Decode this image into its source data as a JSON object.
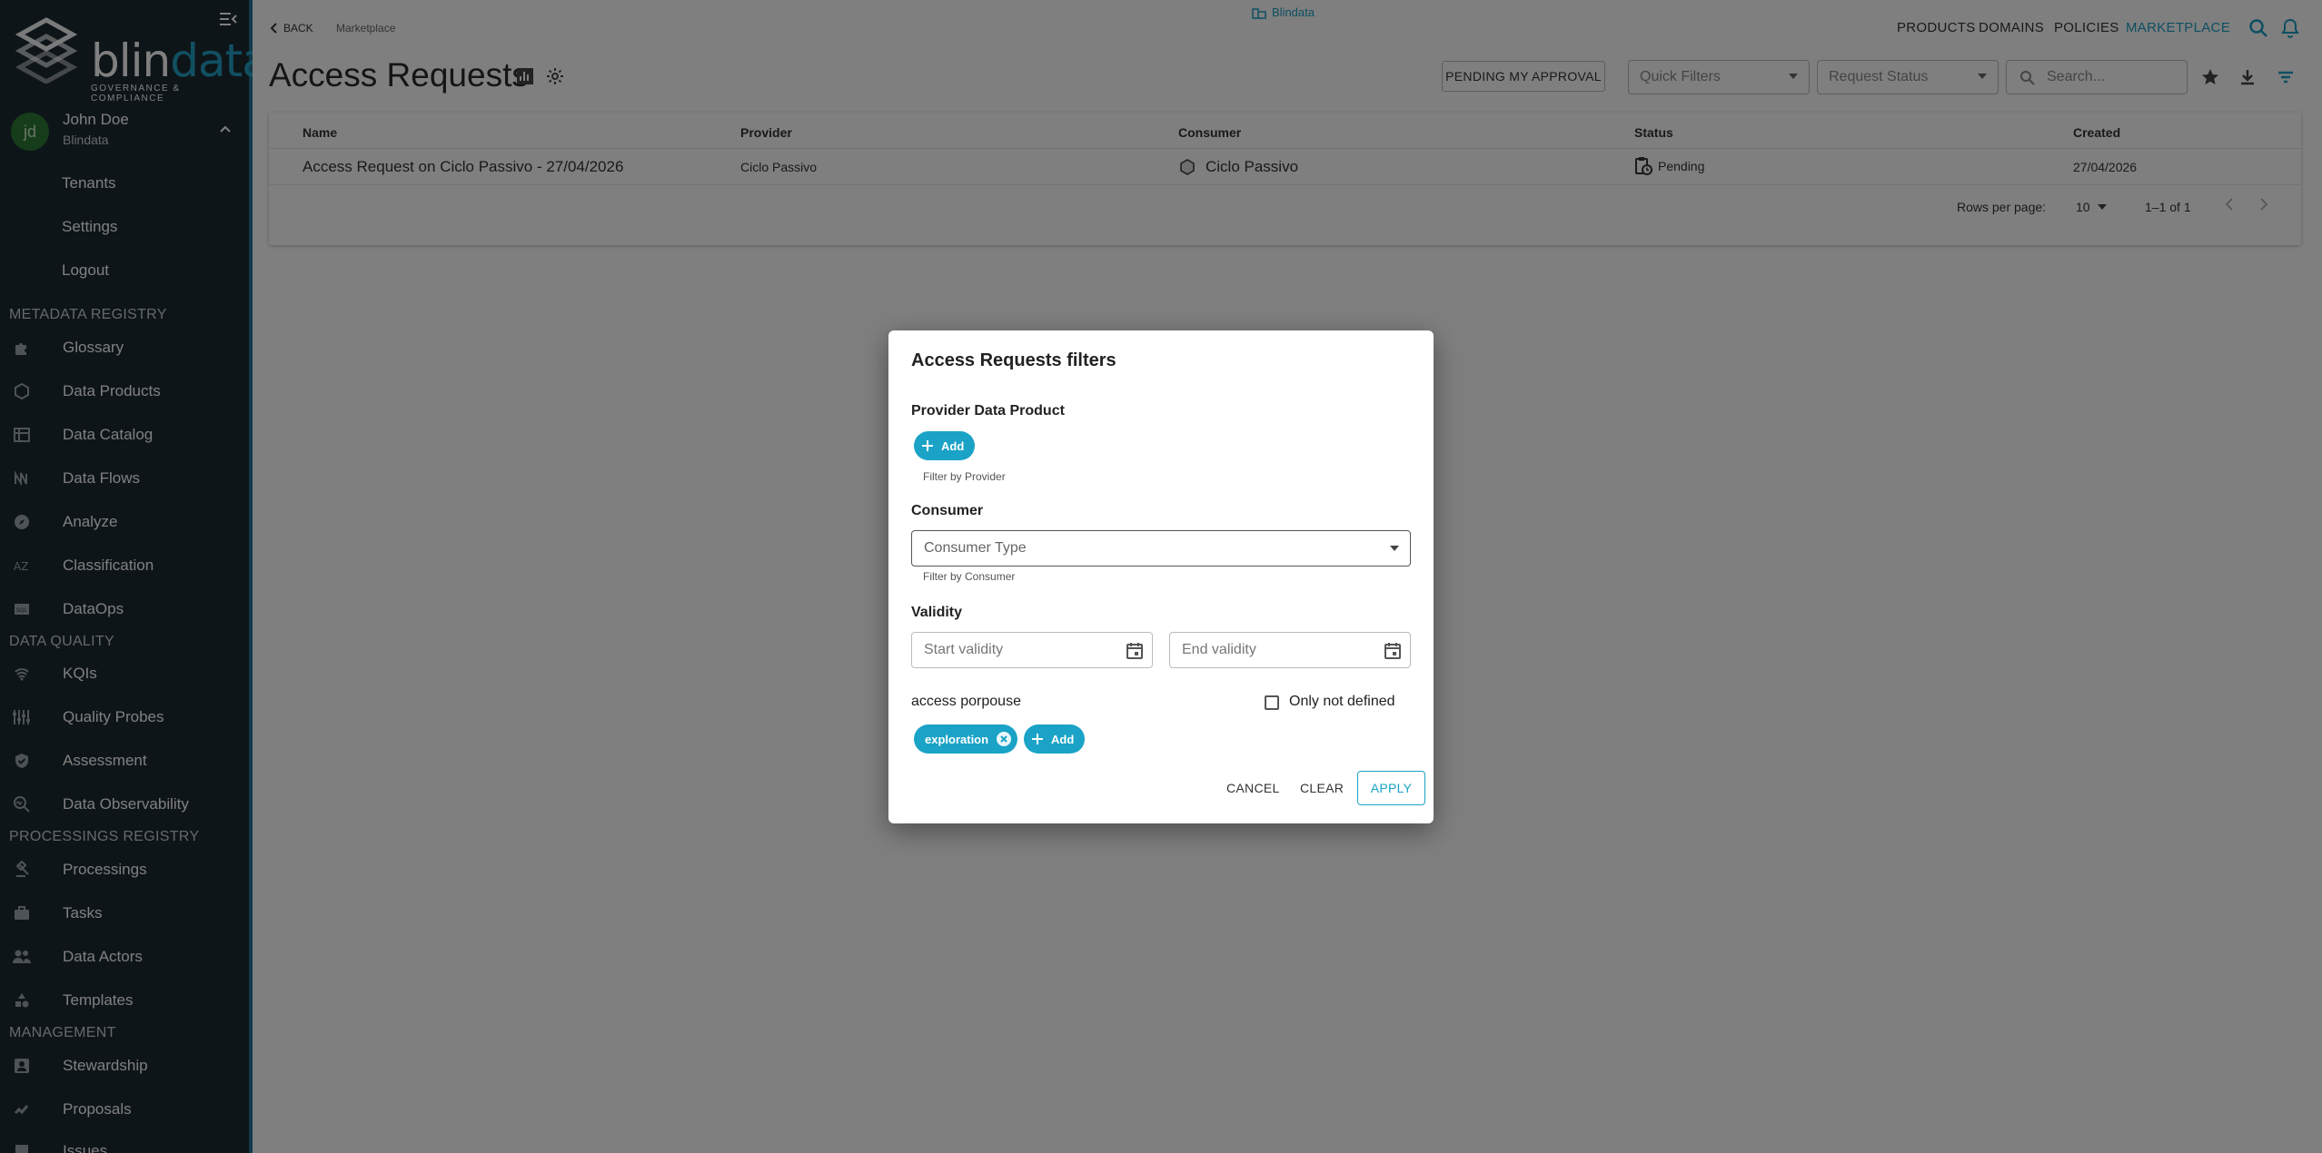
{
  "sidebar": {
    "logo_text_part1": "blin",
    "logo_text_part2": "data",
    "logo_subtitle": "GOVERNANCE & COMPLIANCE",
    "user": {
      "initials": "jd",
      "name": "John Doe",
      "tenant": "Blindata"
    },
    "account_links": [
      "Tenants",
      "Settings",
      "Logout"
    ],
    "sections": {
      "metadata": "METADATA REGISTRY",
      "quality": "DATA QUALITY",
      "processings": "PROCESSINGS REGISTRY",
      "management": "MANAGEMENT"
    },
    "metadata_items": [
      "Glossary",
      "Data Products",
      "Data Catalog",
      "Data Flows",
      "Analyze",
      "Classification",
      "DataOps"
    ],
    "quality_items": [
      "KQIs",
      "Quality Probes",
      "Assessment",
      "Data Observability"
    ],
    "processings_items": [
      "Processings",
      "Tasks",
      "Data Actors",
      "Templates"
    ],
    "management_items": [
      "Stewardship",
      "Proposals",
      "Issues"
    ]
  },
  "header": {
    "back_label": "BACK",
    "breadcrumb": "Marketplace",
    "tenant": "Blindata",
    "nav": [
      "PRODUCTS",
      "DOMAINS",
      "POLICIES",
      "MARKETPLACE"
    ],
    "active_nav": "MARKETPLACE"
  },
  "page": {
    "title": "Access Requests",
    "pending_button": "PENDING MY APPROVAL",
    "quick_filters_placeholder": "Quick Filters",
    "request_status_placeholder": "Request Status",
    "search_placeholder": "Search..."
  },
  "table": {
    "columns": [
      "Name",
      "Provider",
      "Consumer",
      "Status",
      "Created"
    ],
    "rows": [
      {
        "name": "Access Request on Ciclo Passivo - 27/04/2026",
        "provider": "Ciclo Passivo",
        "consumer": "Ciclo Passivo",
        "status": "Pending",
        "created": "27/04/2026"
      }
    ],
    "rows_per_page_label": "Rows per page:",
    "rows_per_page": "10",
    "range": "1–1 of 1"
  },
  "dialog": {
    "title": "Access Requests filters",
    "provider_label": "Provider Data Product",
    "add_label": "Add",
    "provider_helper": "Filter by Provider",
    "consumer_label": "Consumer",
    "consumer_type_placeholder": "Consumer Type",
    "consumer_helper": "Filter by Consumer",
    "validity_label": "Validity",
    "start_validity": "Start validity",
    "end_validity": "End validity",
    "purpose_label": "access porpouse",
    "only_not_defined": "Only not defined",
    "purpose_chip": "exploration",
    "cancel": "CANCEL",
    "clear": "CLEAR",
    "apply": "APPLY"
  },
  "colors": {
    "accent": "#1aa3c6",
    "sidebar_bg": "#1d2b33"
  }
}
